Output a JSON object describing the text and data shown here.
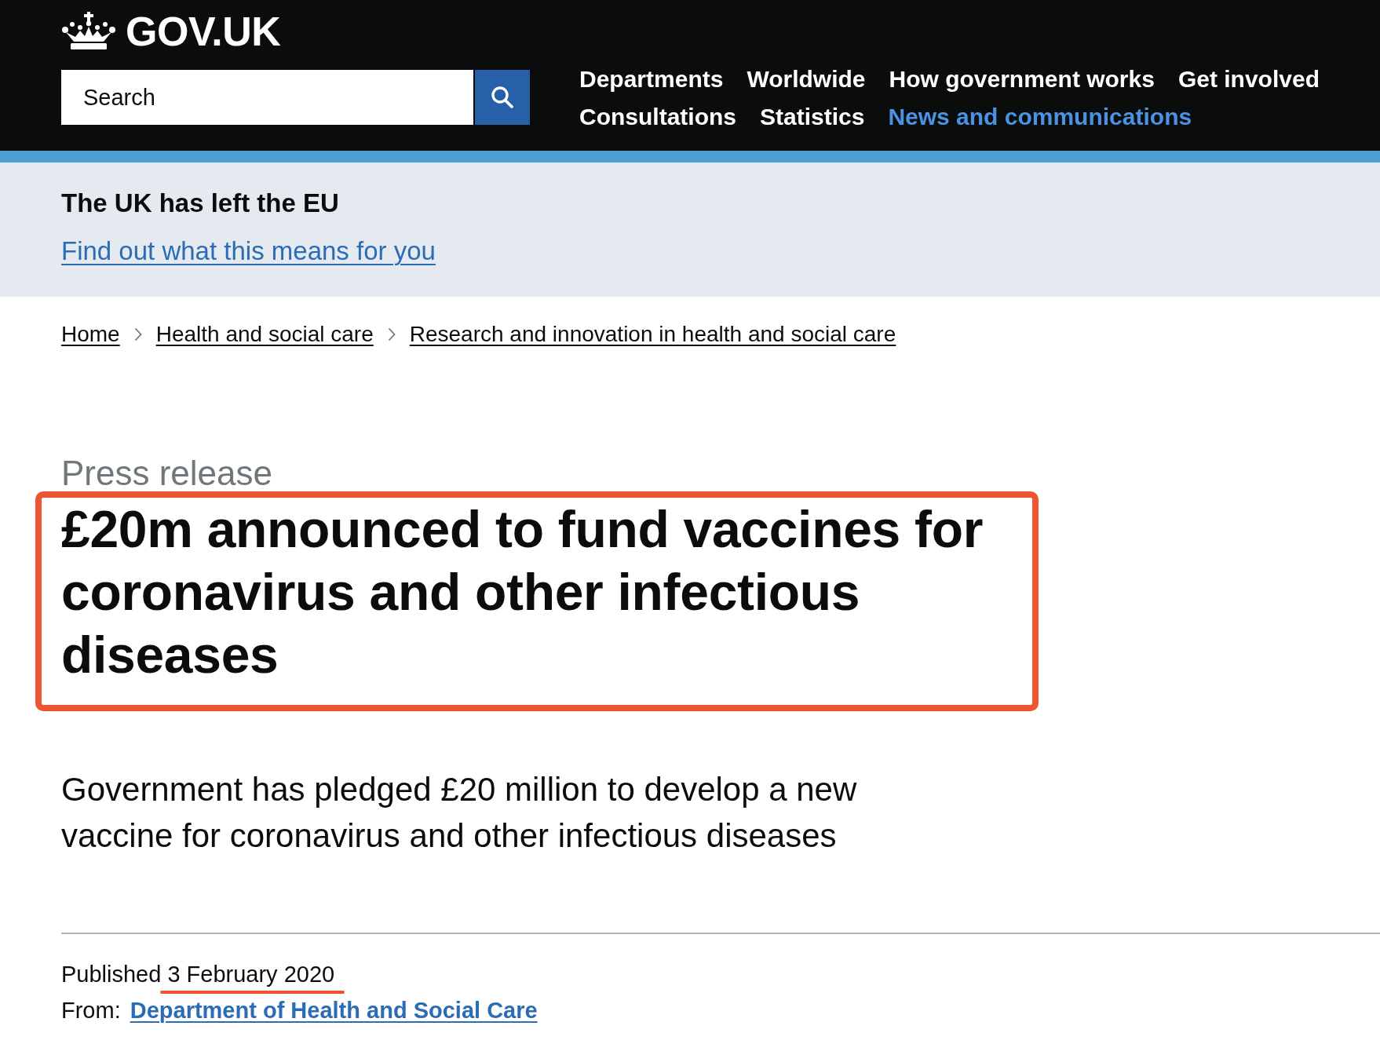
{
  "header": {
    "logo_text": "GOV.UK",
    "search": {
      "placeholder": "Search"
    },
    "nav": [
      {
        "label": "Departments",
        "selected": false
      },
      {
        "label": "Worldwide",
        "selected": false
      },
      {
        "label": "How government works",
        "selected": false
      },
      {
        "label": "Get involved",
        "selected": false
      },
      {
        "label": "Consultations",
        "selected": false
      },
      {
        "label": "Statistics",
        "selected": false
      },
      {
        "label": "News and communications",
        "selected": true
      }
    ]
  },
  "notice_banner": {
    "heading": "The UK has left the EU",
    "link": "Find out what this means for you"
  },
  "breadcrumbs": [
    "Home",
    "Health and social care",
    "Research and innovation in health and social care"
  ],
  "document": {
    "type_label": "Press release",
    "title": "£20m announced to fund vaccines for coronavirus and other infectious diseases",
    "title_highlighted": true,
    "summary": "Government has pledged £20 million to develop a new vaccine for coronavirus and other infectious diseases",
    "metadata": {
      "published_label": "Published",
      "published_date": "3 February 2020",
      "date_underlined": true,
      "from_label": "From:",
      "from_link": "Department of Health and Social Care"
    }
  }
}
